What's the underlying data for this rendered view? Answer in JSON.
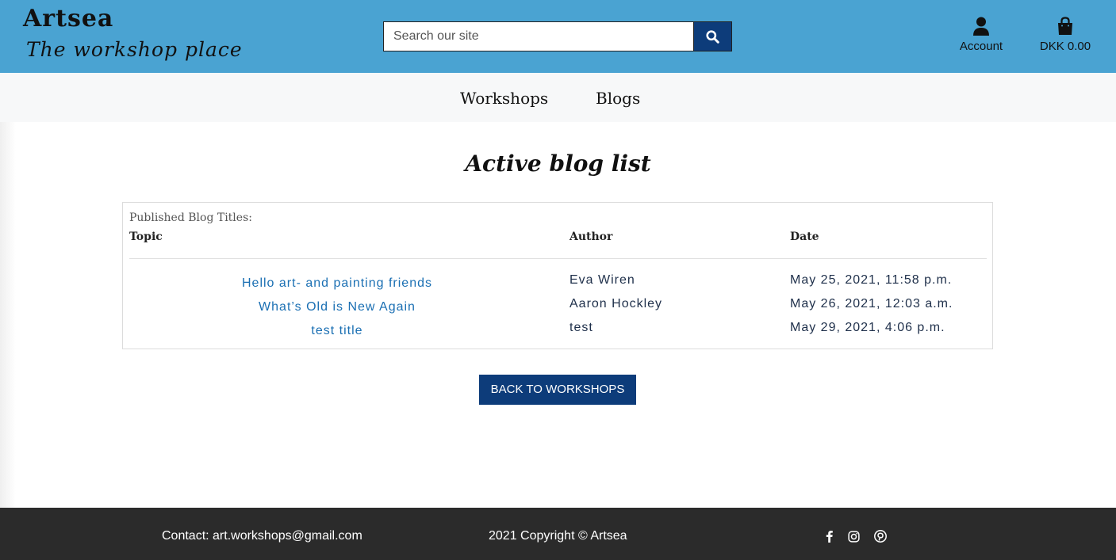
{
  "header": {
    "brand_name": "Artsea",
    "brand_tagline": "The workshop place",
    "search_placeholder": "Search our site",
    "search_icon": "search-icon",
    "account_icon": "user-icon",
    "account_label": "Account",
    "bag_icon": "shopping-bag-icon",
    "bag_total": "DKK 0.00",
    "background_color": "#4aa3d2",
    "accent_color": "#0d3c7a"
  },
  "nav": {
    "items": [
      {
        "label": "Workshops"
      },
      {
        "label": "Blogs"
      }
    ]
  },
  "main": {
    "title": "Active blog list",
    "table": {
      "caption": "Published Blog Titles:",
      "columns": [
        "Topic",
        "Author",
        "Date"
      ],
      "rows": [
        {
          "topic": "Hello art- and painting friends",
          "author": "Eva Wiren",
          "date": "May 25, 2021, 11:58 p.m."
        },
        {
          "topic": "What’s Old is New Again",
          "author": "Aaron Hockley",
          "date": "May 26, 2021, 12:03 a.m."
        },
        {
          "topic": "test title",
          "author": "test",
          "date": "May 29, 2021, 4:06 p.m."
        }
      ]
    },
    "back_button_label": "BACK TO WORKSHOPS"
  },
  "footer": {
    "contact": "Contact: art.workshops@gmail.com",
    "copyright": "2021 Copyright © Artsea",
    "social_icons": [
      "facebook-icon",
      "instagram-icon",
      "pinterest-icon"
    ]
  }
}
